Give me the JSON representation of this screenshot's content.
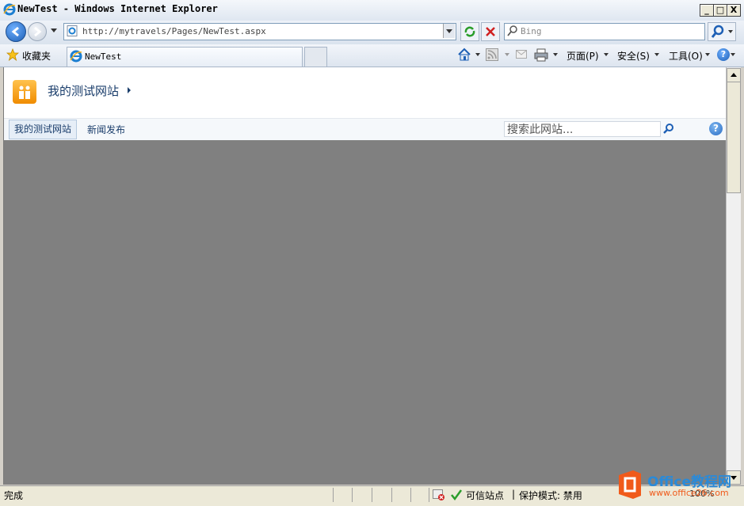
{
  "window": {
    "title": "NewTest - Windows Internet Explorer",
    "buttons": {
      "minimize": "_",
      "maximize": "□",
      "close": "X"
    }
  },
  "nav": {
    "address": "http://mytravels/Pages/NewTest.aspx",
    "search_placeholder": "Bing"
  },
  "commandbar": {
    "favorites": "收藏夹",
    "tab_title": "NewTest",
    "page_menu": "页面(P)",
    "safety_menu": "安全(S)",
    "tools_menu": "工具(O)"
  },
  "site": {
    "title": "我的测试网站",
    "nav_items": [
      "我的测试网站",
      "新闻发布"
    ],
    "search_placeholder": "搜索此网站..."
  },
  "status": {
    "text": "完成",
    "zone": "可信站点",
    "protected_mode": "保护模式: 禁用",
    "zoom": "100%"
  },
  "watermark": {
    "brand": "Office教程网",
    "url": "www.office26.com"
  },
  "colors": {
    "accent": "#1a3d6b",
    "content_gray": "#808080",
    "logo_orange": "#f08c00",
    "watermark_orange": "#f05a1a",
    "watermark_blue": "#2a8ad8"
  }
}
